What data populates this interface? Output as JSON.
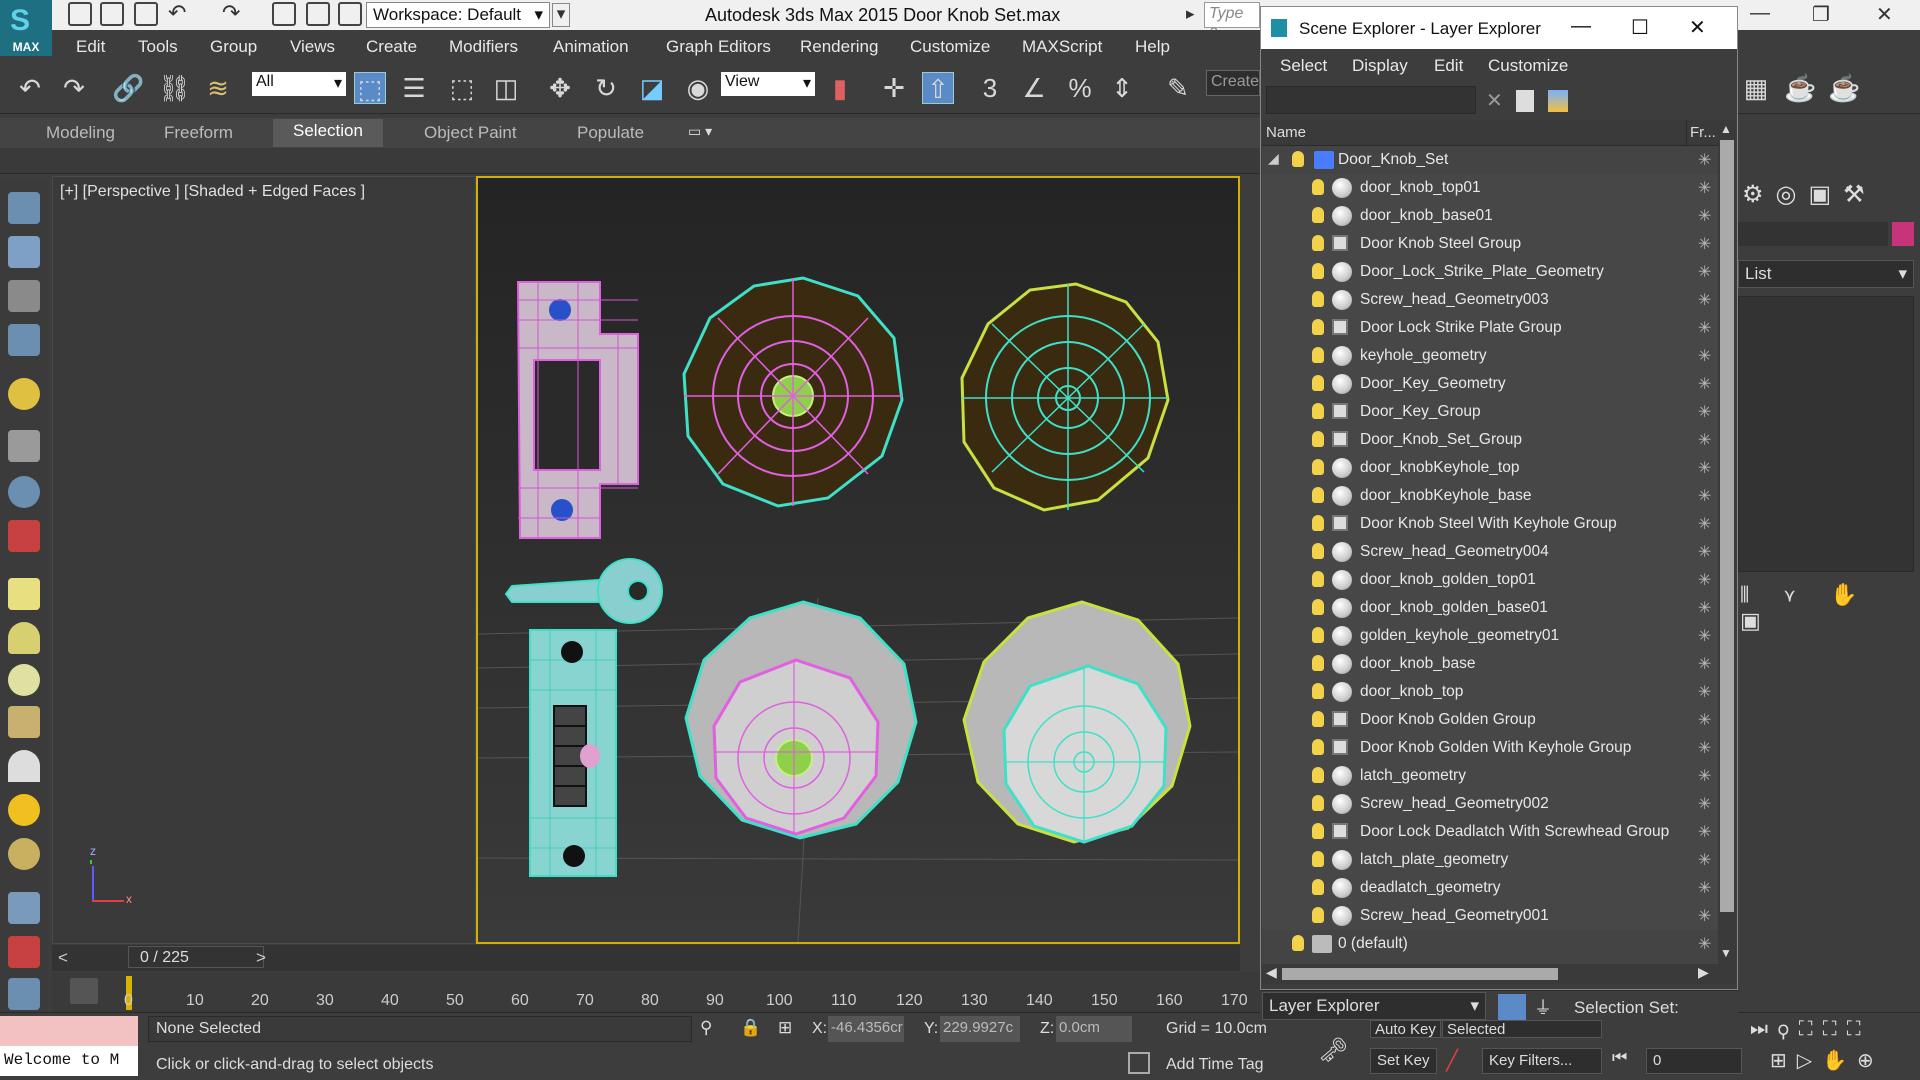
{
  "app": {
    "logo_text": "MAX",
    "workspace": "Workspace: Default",
    "title": "Autodesk 3ds Max  2015     Door Knob Set.max",
    "search_placeholder": "Type a"
  },
  "menus": [
    "Edit",
    "Tools",
    "Group",
    "Views",
    "Create",
    "Modifiers",
    "Animation",
    "Graph Editors",
    "Rendering",
    "Customize",
    "MAXScript",
    "Help"
  ],
  "toolbar": {
    "selection_filter": "All",
    "ref_coord": "View",
    "create_selection_set": "Create"
  },
  "ribbon": {
    "tabs": [
      "Modeling",
      "Freeform",
      "Selection",
      "Object Paint",
      "Populate"
    ],
    "active_tab": "Selection"
  },
  "viewport": {
    "label": "[+] [Perspective ] [Shaded + Edged Faces ]",
    "axis_z": "z",
    "axis_x": "x"
  },
  "timeline": {
    "slider_value": "0 / 225",
    "ticks": [
      "0",
      "10",
      "20",
      "30",
      "40",
      "50",
      "60",
      "70",
      "80",
      "90",
      "100",
      "110",
      "120",
      "130",
      "140",
      "150",
      "160",
      "170"
    ]
  },
  "status": {
    "welcome": "Welcome to M",
    "selection": "None Selected",
    "prompt": "Click or click-and-drag to select objects",
    "x_label": "X:",
    "x_value": "-46.4356cr",
    "y_label": "Y:",
    "y_value": "229.9927c",
    "z_label": "Z:",
    "z_value": "0.0cm",
    "grid": "Grid = 10.0cm",
    "add_time_tag": "Add Time Tag",
    "auto_key": "Auto Key",
    "set_key": "Set Key",
    "selected": "Selected",
    "key_filters": "Key Filters...",
    "frame": "0"
  },
  "command_panel": {
    "list_label": "List"
  },
  "scene_explorer": {
    "title": "Scene Explorer - Layer Explorer",
    "menus": [
      "Select",
      "Display",
      "Edit",
      "Customize"
    ],
    "col_name": "Name",
    "col_frozen": "Fr...",
    "root": "Door_Knob_Set",
    "items": [
      {
        "name": "door_knob_top01",
        "type": "object"
      },
      {
        "name": "door_knob_base01",
        "type": "object"
      },
      {
        "name": "Door Knob Steel Group",
        "type": "group"
      },
      {
        "name": "Door_Lock_Strike_Plate_Geometry",
        "type": "object"
      },
      {
        "name": "Screw_head_Geometry003",
        "type": "object"
      },
      {
        "name": "Door Lock Strike Plate Group",
        "type": "group"
      },
      {
        "name": "keyhole_geometry",
        "type": "object"
      },
      {
        "name": "Door_Key_Geometry",
        "type": "object"
      },
      {
        "name": "Door_Key_Group",
        "type": "group"
      },
      {
        "name": "Door_Knob_Set_Group",
        "type": "group"
      },
      {
        "name": "door_knobKeyhole_top",
        "type": "object"
      },
      {
        "name": "door_knobKeyhole_base",
        "type": "object"
      },
      {
        "name": "Door Knob Steel With Keyhole Group",
        "type": "group"
      },
      {
        "name": "Screw_head_Geometry004",
        "type": "object"
      },
      {
        "name": "door_knob_golden_top01",
        "type": "object"
      },
      {
        "name": "door_knob_golden_base01",
        "type": "object"
      },
      {
        "name": "golden_keyhole_geometry01",
        "type": "object"
      },
      {
        "name": "door_knob_base",
        "type": "object"
      },
      {
        "name": "door_knob_top",
        "type": "object"
      },
      {
        "name": "Door Knob Golden Group",
        "type": "group"
      },
      {
        "name": "Door Knob Golden With Keyhole Group",
        "type": "group"
      },
      {
        "name": "latch_geometry",
        "type": "object"
      },
      {
        "name": "Screw_head_Geometry002",
        "type": "object"
      },
      {
        "name": "Door Lock Deadlatch With Screwhead Group",
        "type": "group"
      },
      {
        "name": "latch_plate_geometry",
        "type": "object"
      },
      {
        "name": "deadlatch_geometry",
        "type": "object"
      },
      {
        "name": "Screw_head_Geometry001",
        "type": "object"
      }
    ],
    "default_layer": "0 (default)",
    "bottom_dropdown": "Layer Explorer",
    "selection_set": "Selection Set:"
  },
  "colors": {
    "viewport_border": "#d2b000",
    "accent_wire_cyan": "#3fe0c8",
    "accent_wire_magenta": "#e060e0",
    "accent_wire_yellow": "#c8e040",
    "material_swatch": "#c8347a"
  }
}
